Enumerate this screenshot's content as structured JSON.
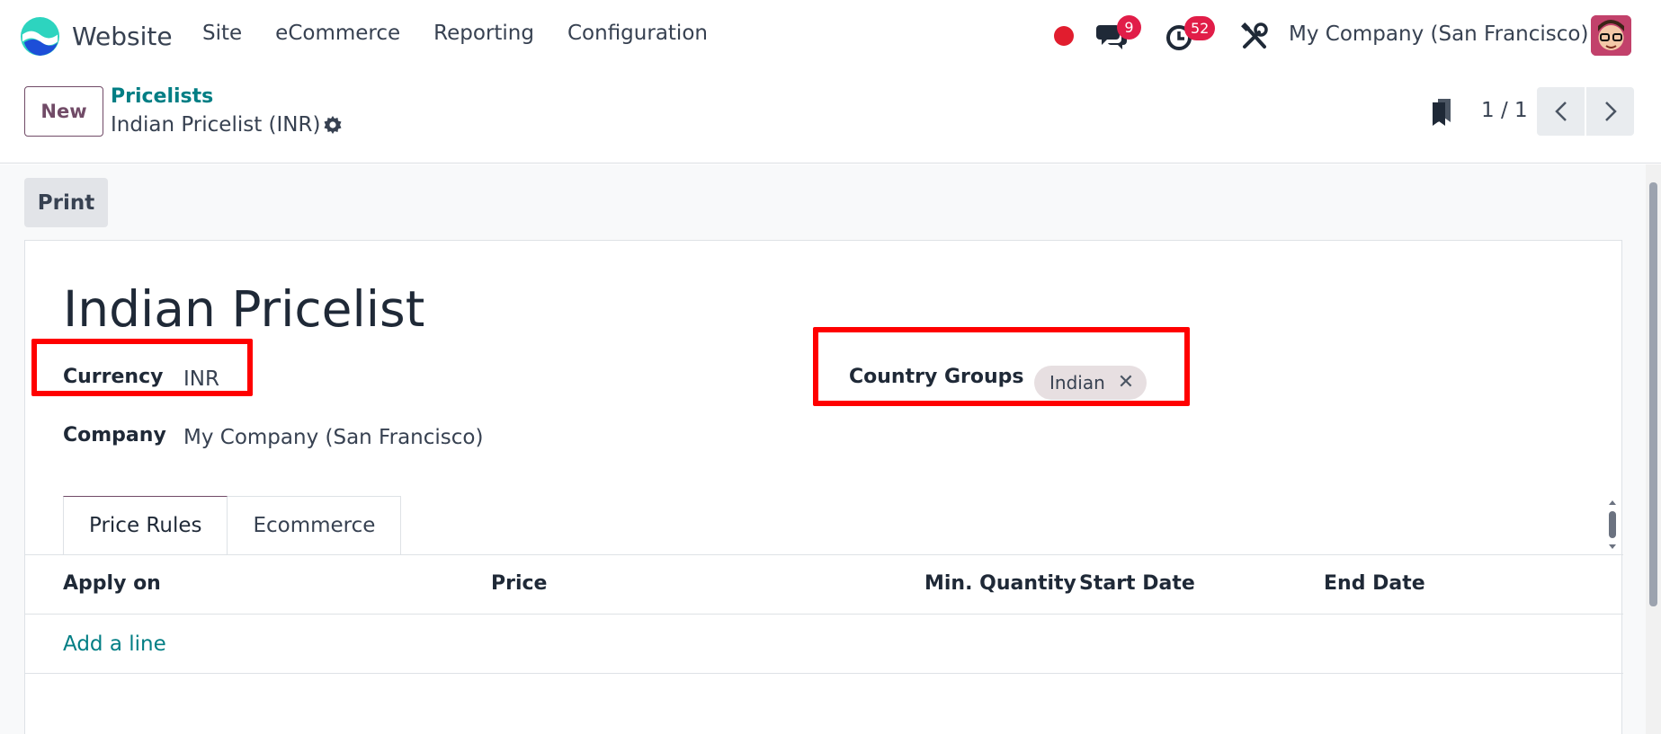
{
  "navbar": {
    "app_name": "Website",
    "menu": [
      "Site",
      "eCommerce",
      "Reporting",
      "Configuration"
    ],
    "messages_count": "9",
    "activities_count": "52",
    "company": "My Company (San Francisco)"
  },
  "breadcrumb": {
    "parent": "Pricelists",
    "current": "Indian Pricelist (INR)"
  },
  "control": {
    "new_label": "New",
    "pager": "1 / 1"
  },
  "actions": {
    "print_label": "Print"
  },
  "form": {
    "title": "Indian Pricelist",
    "currency_label": "Currency",
    "currency_value": "INR",
    "company_label": "Company",
    "company_value": "My Company (San Francisco)",
    "country_groups_label": "Country Groups",
    "country_groups": [
      "Indian"
    ]
  },
  "tabs": [
    "Price Rules",
    "Ecommerce"
  ],
  "table": {
    "columns": [
      "Apply on",
      "Price",
      "Min. Quantity",
      "Start Date",
      "End Date"
    ],
    "add_line": "Add a line"
  },
  "colors": {
    "brand_purple": "#714b67",
    "link_teal": "#017e84",
    "badge_red": "#e11d48",
    "highlight_red": "#ff0000"
  }
}
